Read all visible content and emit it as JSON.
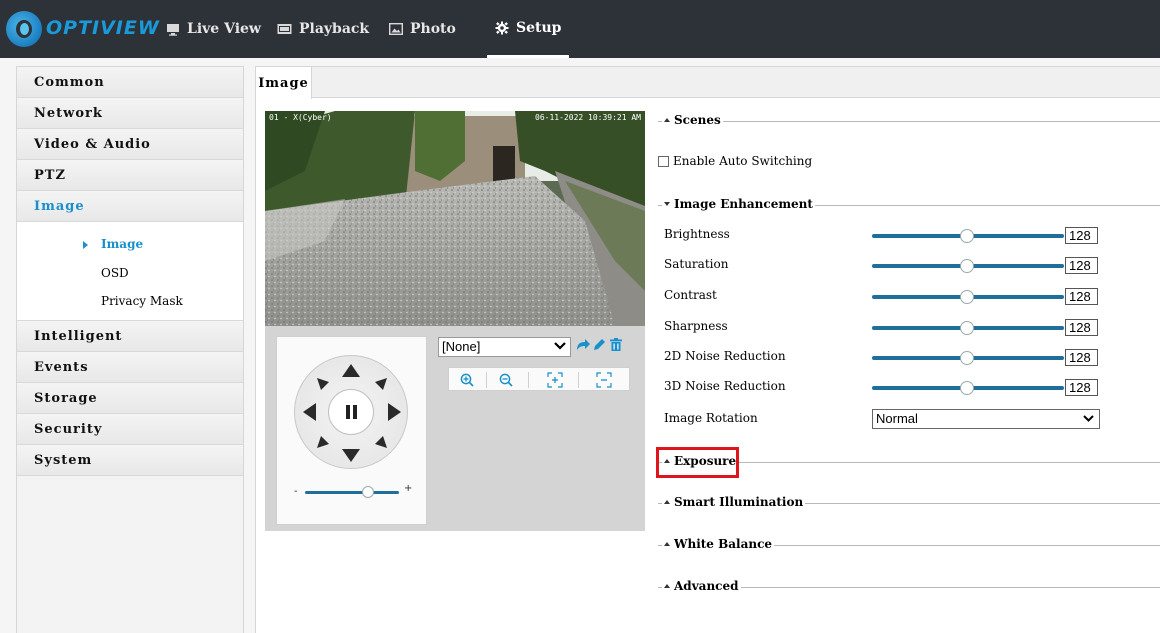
{
  "nav": {
    "brand": "OPTIVIEW",
    "tabs": [
      {
        "label": "Live View",
        "icon": "monitor-icon"
      },
      {
        "label": "Playback",
        "icon": "film-icon"
      },
      {
        "label": "Photo",
        "icon": "photo-icon"
      },
      {
        "label": "Setup",
        "icon": "gear-icon"
      }
    ],
    "active_tab": "Setup"
  },
  "sidebar": {
    "items": [
      "Common",
      "Network",
      "Video & Audio",
      "PTZ",
      "Image",
      "Intelligent",
      "Events",
      "Storage",
      "Security",
      "System"
    ],
    "active_item": "Image",
    "image_submenu": [
      "Image",
      "OSD",
      "Privacy Mask"
    ],
    "active_subitem": "Image"
  },
  "tabs": {
    "active": "Image"
  },
  "video": {
    "osd_left": "01 - X(Cyber)",
    "osd_right": "06-11-2022 10:39:21 AM"
  },
  "ptz": {
    "preset_value": "[None]",
    "speed_min_label": "-",
    "speed_max_label": "+",
    "speed_level": 0.67
  },
  "settings": {
    "scenes": {
      "title": "Scenes",
      "auto_switch_label": "Enable Auto Switching",
      "auto_switch_checked": false
    },
    "enhancement": {
      "title": "Image Enhancement",
      "rows": [
        {
          "label": "Brightness",
          "value": "128"
        },
        {
          "label": "Saturation",
          "value": "128"
        },
        {
          "label": "Contrast",
          "value": "128"
        },
        {
          "label": "Sharpness",
          "value": "128"
        },
        {
          "label": "2D Noise Reduction",
          "value": "128"
        },
        {
          "label": "3D Noise Reduction",
          "value": "128"
        }
      ],
      "rotation_label": "Image Rotation",
      "rotation_value": "Normal"
    },
    "exposure": {
      "title": "Exposure"
    },
    "smart_illumination": {
      "title": "Smart Illumination"
    },
    "white_balance": {
      "title": "White Balance"
    },
    "advanced": {
      "title": "Advanced"
    }
  },
  "colors": {
    "accent": "#1890cc",
    "topbar": "#2d3138",
    "slider": "#1f6f9a",
    "highlight": "#e0141d"
  }
}
